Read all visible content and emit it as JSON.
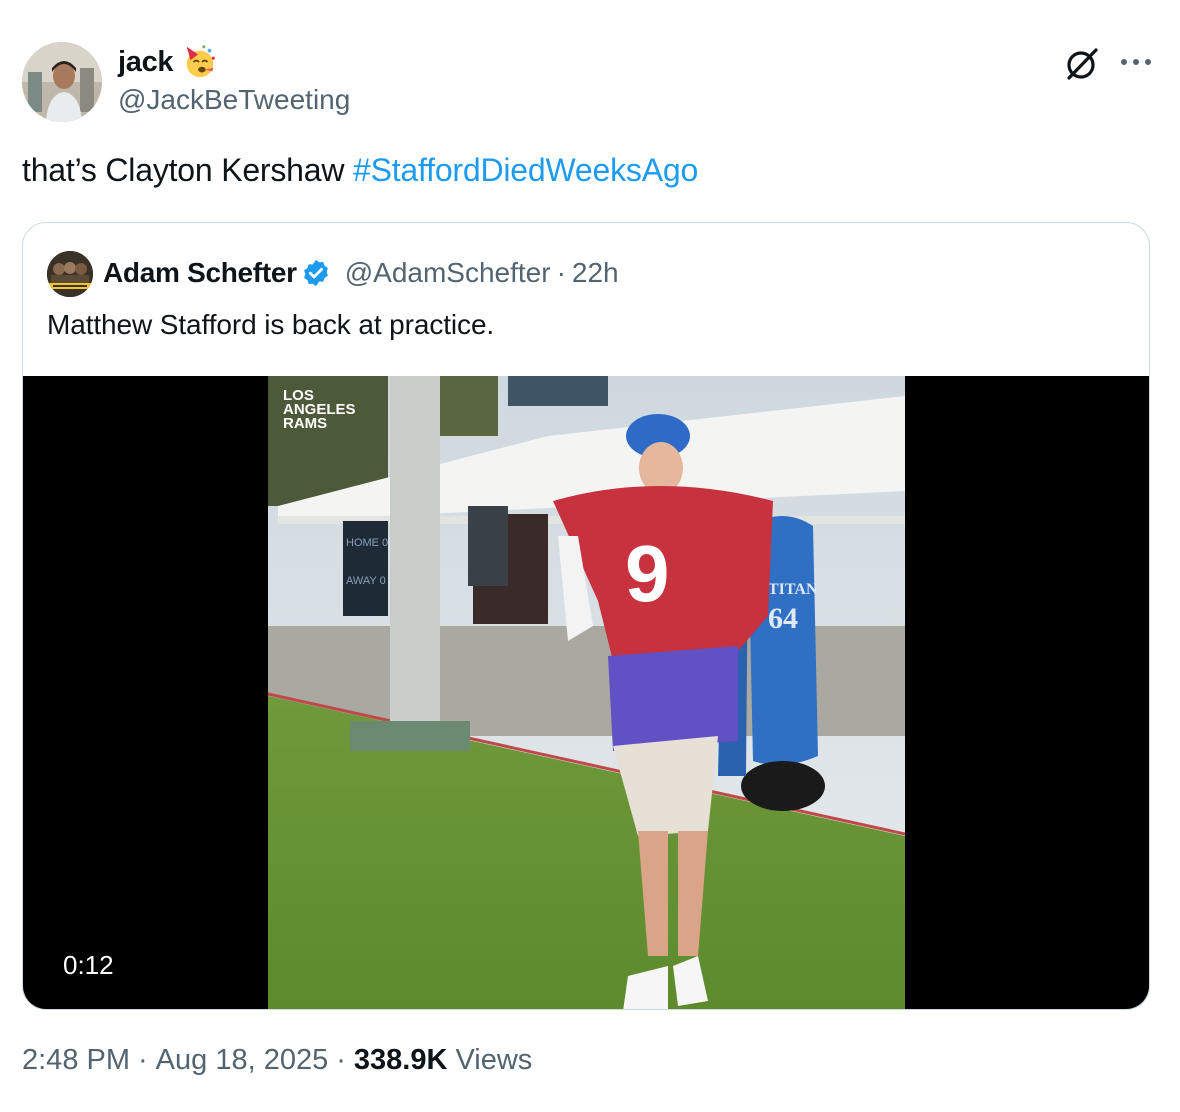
{
  "author": {
    "display_name": "jack",
    "handle": "@JackBeTweeting"
  },
  "icons": {
    "name_emoji": "partying-face-icon",
    "grok": "grok-icon",
    "more": "more-icon",
    "verified": "verified-badge-icon"
  },
  "tweet": {
    "text_prefix": "that’s Clayton Kershaw ",
    "hashtag": "#StaffordDiedWeeksAgo"
  },
  "quote": {
    "display_name": "Adam Schefter",
    "handle": "@AdamSchefter",
    "separator": "·",
    "time": "22h",
    "text": "Matthew Stafford is back at practice.",
    "video": {
      "duration": "0:12",
      "watermark_lines": [
        "LOS",
        "ANGELES",
        "RAMS"
      ],
      "jersey_number": "9",
      "dummy_label": "TITAN",
      "dummy_number": "64",
      "scoreboard_lines": [
        "HOME 0",
        "AWAY 0"
      ]
    }
  },
  "footer": {
    "time": "2:48 PM",
    "sep1": "·",
    "date": "Aug 18, 2025",
    "sep2": "·",
    "views_count": "338.9K",
    "views_label": "Views"
  },
  "colors": {
    "link": "#1d9bf0",
    "secondary_text": "#536471",
    "border": "#cfd9de",
    "verified": "#1d9bf0"
  }
}
